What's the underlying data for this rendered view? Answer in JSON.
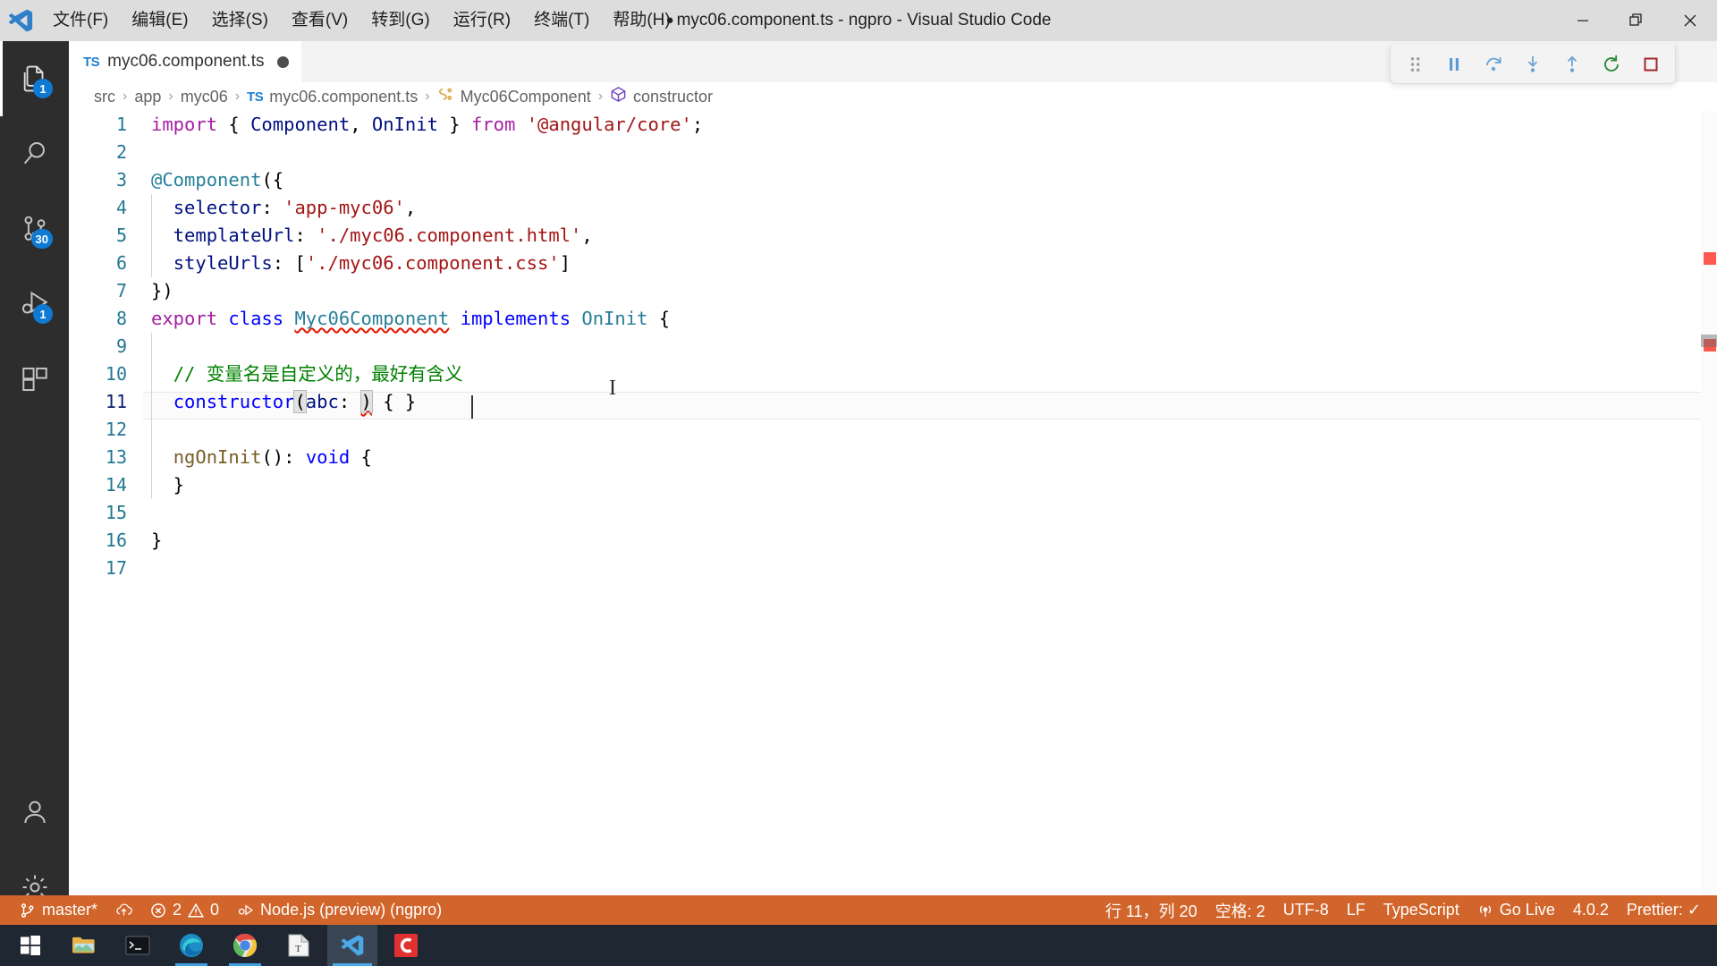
{
  "titlebar": {
    "logo_icon": "vscode-logo-icon",
    "menus": [
      {
        "label": "文件(F)",
        "name": "menu-file"
      },
      {
        "label": "编辑(E)",
        "name": "menu-edit"
      },
      {
        "label": "选择(S)",
        "name": "menu-selection"
      },
      {
        "label": "查看(V)",
        "name": "menu-view"
      },
      {
        "label": "转到(G)",
        "name": "menu-goto"
      },
      {
        "label": "运行(R)",
        "name": "menu-run"
      },
      {
        "label": "终端(T)",
        "name": "menu-terminal"
      },
      {
        "label": "帮助(H)",
        "name": "menu-help"
      }
    ],
    "dirty_indicator": "●",
    "window_title": "myc06.component.ts - ngpro - Visual Studio Code",
    "minimize_label": "最小化",
    "maximize_label": "还原",
    "close_label": "关闭"
  },
  "activitybar": {
    "items": [
      {
        "name": "activity-explorer",
        "icon": "files-icon",
        "badge": "1",
        "active": true
      },
      {
        "name": "activity-search",
        "icon": "search-icon",
        "badge": "",
        "active": false
      },
      {
        "name": "activity-source-control",
        "icon": "source-control-icon",
        "badge": "30",
        "active": false
      },
      {
        "name": "activity-run-debug",
        "icon": "run-and-debug-icon",
        "badge": "1",
        "active": false
      },
      {
        "name": "activity-extensions",
        "icon": "extensions-icon",
        "badge": "",
        "active": false
      }
    ],
    "bottom_items": [
      {
        "name": "activity-accounts",
        "icon": "account-icon"
      },
      {
        "name": "activity-settings",
        "icon": "gear-icon"
      }
    ]
  },
  "tabs": [
    {
      "name": "tab-myc06-component-ts",
      "file_type": "TS",
      "label": "myc06.component.ts",
      "dirty": true,
      "active": true
    }
  ],
  "debug_toolbar": {
    "buttons": [
      {
        "name": "debug-drag-handle",
        "icon": "drag-handle-icon",
        "title": "拖动"
      },
      {
        "name": "debug-pause-button",
        "icon": "pause-icon",
        "title": "暂停"
      },
      {
        "name": "debug-step-over-button",
        "icon": "step-over-icon",
        "title": "单步跳过"
      },
      {
        "name": "debug-step-into-button",
        "icon": "step-into-icon",
        "title": "单步调试"
      },
      {
        "name": "debug-step-out-button",
        "icon": "step-out-icon",
        "title": "单步跳出"
      },
      {
        "name": "debug-restart-button",
        "icon": "restart-icon",
        "title": "重启"
      },
      {
        "name": "debug-stop-button",
        "icon": "stop-icon",
        "title": "停止"
      }
    ]
  },
  "breadcrumbs": [
    {
      "label": "src",
      "icon": "",
      "name": "breadcrumb-src"
    },
    {
      "label": "app",
      "icon": "",
      "name": "breadcrumb-app"
    },
    {
      "label": "myc06",
      "icon": "",
      "name": "breadcrumb-myc06"
    },
    {
      "label": "myc06.component.ts",
      "icon": "ts-file-icon",
      "name": "breadcrumb-file"
    },
    {
      "label": "Myc06Component",
      "icon": "class-symbol-icon",
      "name": "breadcrumb-class"
    },
    {
      "label": "constructor",
      "icon": "method-symbol-icon",
      "name": "breadcrumb-constructor"
    }
  ],
  "breadcrumb_separator": "›",
  "editor": {
    "cursor_line": 11,
    "cursor_column": 20,
    "lines": [
      {
        "n": "1",
        "tokens": [
          {
            "t": "import",
            "c": "t-key"
          },
          {
            "t": " ",
            "c": "t-plain"
          },
          {
            "t": "{",
            "c": "t-punc"
          },
          {
            "t": " ",
            "c": "t-plain"
          },
          {
            "t": "Component",
            "c": "t-id"
          },
          {
            "t": ", ",
            "c": "t-punc"
          },
          {
            "t": "OnInit",
            "c": "t-id"
          },
          {
            "t": " ",
            "c": "t-plain"
          },
          {
            "t": "}",
            "c": "t-punc"
          },
          {
            "t": " ",
            "c": "t-plain"
          },
          {
            "t": "from",
            "c": "t-key"
          },
          {
            "t": " ",
            "c": "t-plain"
          },
          {
            "t": "'@angular/core'",
            "c": "t-str"
          },
          {
            "t": ";",
            "c": "t-punc"
          }
        ]
      },
      {
        "n": "2",
        "tokens": []
      },
      {
        "n": "3",
        "tokens": [
          {
            "t": "@",
            "c": "t-class"
          },
          {
            "t": "Component",
            "c": "t-class"
          },
          {
            "t": "({",
            "c": "t-punc"
          }
        ]
      },
      {
        "n": "4",
        "tokens": [
          {
            "t": "  ",
            "c": "t-plain"
          },
          {
            "t": "selector",
            "c": "t-id"
          },
          {
            "t": ": ",
            "c": "t-punc"
          },
          {
            "t": "'app-myc06'",
            "c": "t-str"
          },
          {
            "t": ",",
            "c": "t-punc"
          }
        ]
      },
      {
        "n": "5",
        "tokens": [
          {
            "t": "  ",
            "c": "t-plain"
          },
          {
            "t": "templateUrl",
            "c": "t-id"
          },
          {
            "t": ": ",
            "c": "t-punc"
          },
          {
            "t": "'./myc06.component.html'",
            "c": "t-str"
          },
          {
            "t": ",",
            "c": "t-punc"
          }
        ]
      },
      {
        "n": "6",
        "tokens": [
          {
            "t": "  ",
            "c": "t-plain"
          },
          {
            "t": "styleUrls",
            "c": "t-id"
          },
          {
            "t": ": [",
            "c": "t-punc"
          },
          {
            "t": "'./myc06.component.css'",
            "c": "t-str"
          },
          {
            "t": "]",
            "c": "t-punc"
          }
        ]
      },
      {
        "n": "7",
        "tokens": [
          {
            "t": "})",
            "c": "t-punc"
          }
        ]
      },
      {
        "n": "8",
        "tokens": [
          {
            "t": "export",
            "c": "t-key"
          },
          {
            "t": " ",
            "c": "t-plain"
          },
          {
            "t": "class",
            "c": "t-kw2"
          },
          {
            "t": " ",
            "c": "t-plain"
          },
          {
            "t": "Myc06Component",
            "c": "t-class squiggle"
          },
          {
            "t": " ",
            "c": "t-plain"
          },
          {
            "t": "implements",
            "c": "t-kw2"
          },
          {
            "t": " ",
            "c": "t-plain"
          },
          {
            "t": "OnInit",
            "c": "t-class"
          },
          {
            "t": " {",
            "c": "t-punc"
          }
        ]
      },
      {
        "n": "9",
        "tokens": []
      },
      {
        "n": "10",
        "tokens": [
          {
            "t": "  ",
            "c": "t-plain"
          },
          {
            "t": "// 变量名是自定义的，最好有含义",
            "c": "t-com"
          }
        ]
      },
      {
        "n": "11",
        "tokens": [
          {
            "t": "  ",
            "c": "t-plain"
          },
          {
            "t": "constructor",
            "c": "t-kw2"
          },
          {
            "t": "(",
            "c": "t-punc brk-match"
          },
          {
            "t": "abc",
            "c": "t-id"
          },
          {
            "t": ": ",
            "c": "t-punc"
          },
          {
            "t": ")",
            "c": "t-punc brk-match squiggle"
          },
          {
            "t": " { }",
            "c": "t-punc"
          }
        ]
      },
      {
        "n": "12",
        "tokens": []
      },
      {
        "n": "13",
        "tokens": [
          {
            "t": "  ",
            "c": "t-plain"
          },
          {
            "t": "ngOnInit",
            "c": "t-fn"
          },
          {
            "t": "(): ",
            "c": "t-punc"
          },
          {
            "t": "void",
            "c": "t-kw2"
          },
          {
            "t": " {",
            "c": "t-punc"
          }
        ]
      },
      {
        "n": "14",
        "tokens": [
          {
            "t": "  }",
            "c": "t-punc"
          }
        ]
      },
      {
        "n": "15",
        "tokens": []
      },
      {
        "n": "16",
        "tokens": [
          {
            "t": "}",
            "c": "t-punc"
          }
        ]
      },
      {
        "n": "17",
        "tokens": []
      }
    ]
  },
  "statusbar": {
    "left": [
      {
        "name": "status-branch",
        "icon": "source-control-branch-icon",
        "label": "master*"
      },
      {
        "name": "status-sync",
        "icon": "cloud-upload-icon",
        "label": ""
      },
      {
        "name": "status-problems",
        "icon": "error-warning-icon",
        "label": "2 ⚠ 0",
        "errors": "2",
        "warnings": "0"
      },
      {
        "name": "status-debug-target",
        "icon": "debug-icon",
        "label": "Node.js (preview) (ngpro)"
      }
    ],
    "right": [
      {
        "name": "status-cursor-position",
        "icon": "",
        "label": "行 11，列 20"
      },
      {
        "name": "status-indentation",
        "icon": "",
        "label": "空格: 2"
      },
      {
        "name": "status-encoding",
        "icon": "",
        "label": "UTF-8"
      },
      {
        "name": "status-eol",
        "icon": "",
        "label": "LF"
      },
      {
        "name": "status-language-mode",
        "icon": "",
        "label": "TypeScript"
      },
      {
        "name": "status-go-live",
        "icon": "broadcast-icon",
        "label": "Go Live"
      },
      {
        "name": "status-version",
        "icon": "",
        "label": "4.0.2"
      },
      {
        "name": "status-prettier",
        "icon": "",
        "label": "Prettier: ✓"
      }
    ]
  },
  "taskbar": {
    "items": [
      {
        "name": "taskbar-start-button",
        "icon": "windows-start-icon"
      },
      {
        "name": "taskbar-file-explorer",
        "icon": "folder-icon"
      },
      {
        "name": "taskbar-terminal",
        "icon": "terminal-icon"
      },
      {
        "name": "taskbar-edge",
        "icon": "edge-icon"
      },
      {
        "name": "taskbar-chrome",
        "icon": "chrome-icon"
      },
      {
        "name": "taskbar-text-editor",
        "icon": "text-editor-icon"
      },
      {
        "name": "taskbar-vscode",
        "icon": "vscode-icon"
      },
      {
        "name": "taskbar-app-c",
        "icon": "c-app-icon"
      }
    ]
  }
}
